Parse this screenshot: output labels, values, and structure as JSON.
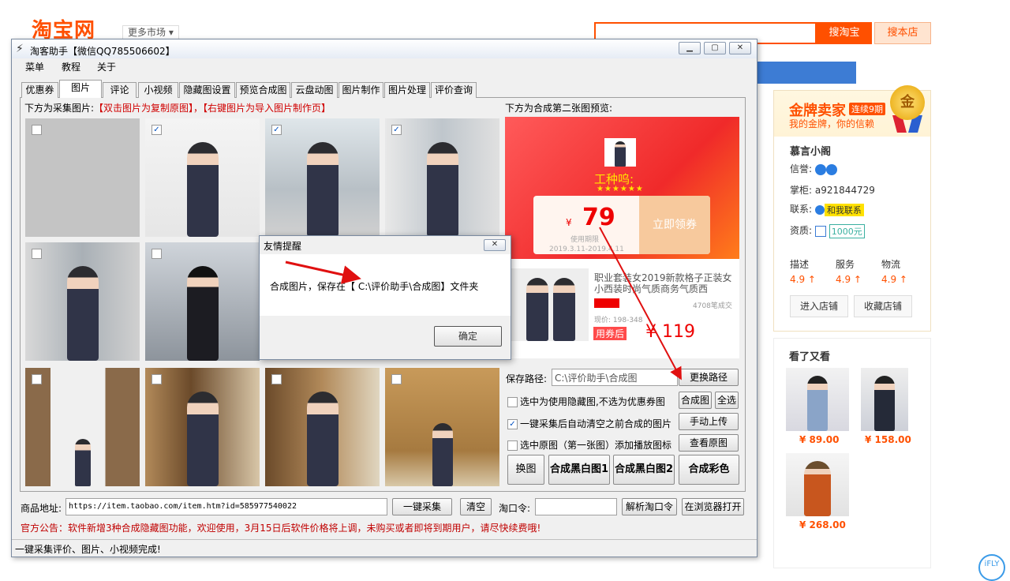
{
  "bg_page": {
    "logo": "淘宝网",
    "more_market": "更多市场",
    "search_btn": "搜淘宝",
    "shop_btn": "搜本店",
    "seller": {
      "gold_title": "金牌卖家",
      "gold_badge": "连续9期",
      "gold_sub": "我的金牌，你的信赖",
      "medal": "金",
      "shop_name": "慕言小阁",
      "credit_label": "信誉:",
      "owner": "掌柜: a921844729",
      "contact_label": "联系:",
      "contact_tag": "和我联系",
      "zizhi_label": "资质:",
      "zizhi_tag": "1000元",
      "ratings": [
        {
          "label": "描述",
          "value": "4.9 ↑"
        },
        {
          "label": "服务",
          "value": "4.9 ↑"
        },
        {
          "label": "物流",
          "value": "4.9 ↑"
        }
      ],
      "enter_shop": "进入店铺",
      "fav_shop": "收藏店铺"
    },
    "seen": {
      "title": "看了又看",
      "items": [
        {
          "price": "¥ 89.00"
        },
        {
          "price": "¥ 158.00"
        },
        {
          "price": "¥ 268.00"
        }
      ]
    },
    "ifly": "iFLY"
  },
  "app": {
    "title": "淘客助手【微信QQ785506602】",
    "menu": [
      "菜单",
      "教程",
      "关于"
    ],
    "tabs": [
      "优惠券",
      "图片",
      "评论",
      "小视频",
      "隐藏图设置",
      "预览合成图",
      "云盘动图",
      "图片制作",
      "图片处理",
      "评价查询"
    ],
    "active_tab": "图片",
    "collect_label": "下方为采集图片:",
    "collect_hint": "【双击图片为复制原图】，【右键图片为导入图片制作页】",
    "preview_label": "下方为合成第二张图预览:",
    "preview": {
      "headline": "工种呜:",
      "stars": "★★★★★★",
      "yen": "¥",
      "price": "79",
      "claim": "立即领券",
      "date_label": "使用期限",
      "date_range": "2019.3.11-2019.4.11",
      "product_title": "职业套装女2019新款格子正装女小西装时尚气质商务气质西",
      "sold": "4708笔成交",
      "now_price": "现价: 198-348",
      "coupon_tag": "用券后",
      "final_price": "¥ 119"
    },
    "save_label": "保存路径:",
    "save_path": "C:\\评价助手\\合成图",
    "change_path": "更换路径",
    "opt_hidden": "选中为使用隐藏图,不选为优惠券图",
    "btn_compose": "合成图",
    "btn_select_all": "全选",
    "opt_autoclear": "一键采集后自动清空之前合成的图片",
    "btn_manual_upload": "手动上传",
    "opt_playicon": "选中原图（第一张图）添加播放图标",
    "btn_view_orig": "查看原图",
    "btn_swap": "换图",
    "btn_bw1": "合成黑白图1",
    "btn_bw2": "合成黑白图2",
    "btn_color": "合成彩色",
    "url_label": "商品地址:",
    "url_value": "https://item.taobao.com/item.htm?id=585977540022",
    "btn_collect": "一键采集",
    "btn_clear": "清空",
    "kl_label": "淘口令:",
    "btn_parse_kl": "解析淘口令",
    "btn_open_browser": "在浏览器打开",
    "notice": "官方公告：软件新增3种合成隐藏图功能，欢迎使用，3月15日后软件价格将上调，未购买或者即将到期用户，请尽快续费哦!",
    "status": "一键采集评价、图片、小视频完成!"
  },
  "dialog": {
    "title": "友情提醒",
    "message": "合成图片，保存在【 C:\\评价助手\\合成图】文件夹",
    "ok": "确定"
  },
  "colors": {
    "accent": "#ff5000",
    "notice": "#c00000",
    "arrow": "#e01010"
  }
}
